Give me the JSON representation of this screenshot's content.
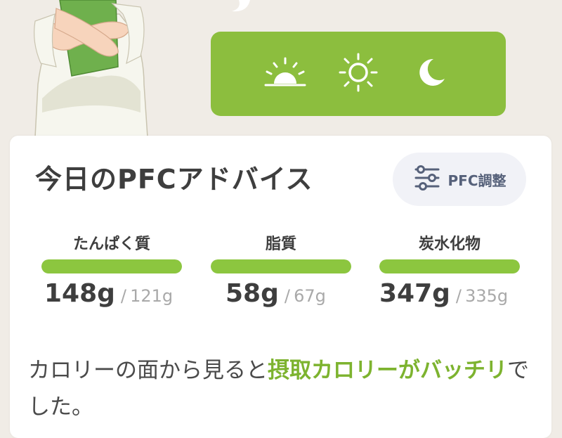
{
  "time_selector": {
    "buttons": [
      {
        "icon": "sunrise-icon"
      },
      {
        "icon": "sun-icon"
      },
      {
        "icon": "moon-icon"
      }
    ],
    "color": "#8cbe3e"
  },
  "card": {
    "title": "今日のPFCアドバイス",
    "adjust_button": {
      "label": "PFC調整",
      "icon": "sliders-icon"
    },
    "nutrients": [
      {
        "label": "たんぱく質",
        "actual": "148g",
        "separator": "/",
        "target": "121g",
        "progress": 1.0
      },
      {
        "label": "脂質",
        "actual": "58g",
        "separator": "/",
        "target": "67g",
        "progress": 1.0
      },
      {
        "label": "炭水化物",
        "actual": "347g",
        "separator": "/",
        "target": "335g",
        "progress": 1.0
      }
    ],
    "advice": {
      "prefix": "カロリーの面から見ると",
      "highlight": "摂取カロリーがバッチリ",
      "suffix": "でした。"
    }
  },
  "colors": {
    "accent_green": "#8cc63f",
    "background": "#f0ece6",
    "text_dark": "#3e3e3e",
    "text_muted": "#a9a9a9"
  }
}
